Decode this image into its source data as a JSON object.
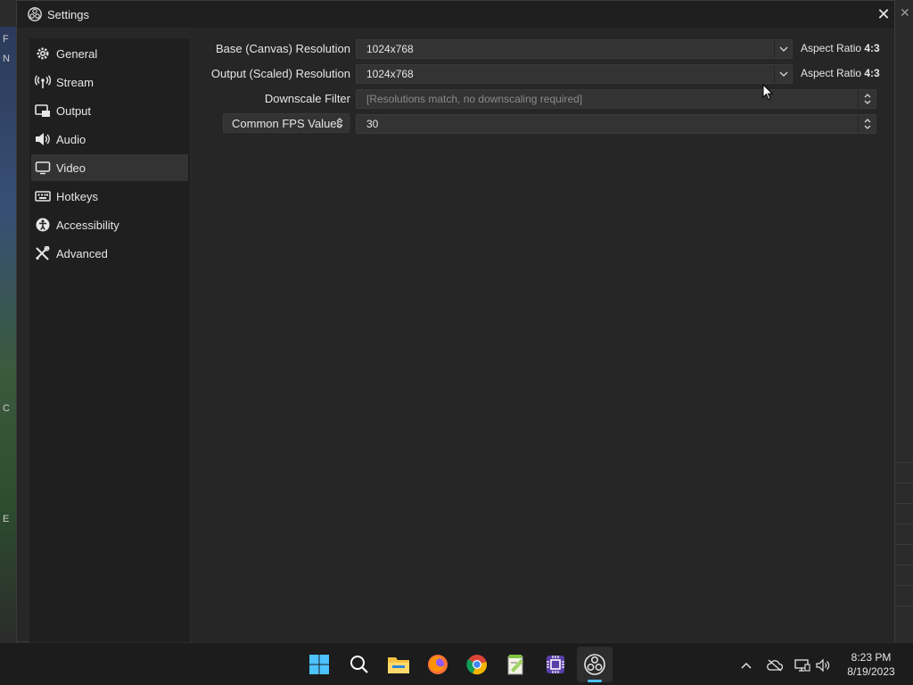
{
  "window": {
    "title": "Settings",
    "close_glyph": "✕"
  },
  "background_app": {
    "edge_texts": [
      "F",
      "N",
      "C",
      "E"
    ],
    "close_glyph": "✕"
  },
  "sidebar": {
    "items": [
      {
        "label": "General",
        "icon": "gear-icon",
        "active": false
      },
      {
        "label": "Stream",
        "icon": "antenna-icon",
        "active": false
      },
      {
        "label": "Output",
        "icon": "output-icon",
        "active": false
      },
      {
        "label": "Audio",
        "icon": "speaker-icon",
        "active": false
      },
      {
        "label": "Video",
        "icon": "monitor-icon",
        "active": true
      },
      {
        "label": "Hotkeys",
        "icon": "keyboard-icon",
        "active": false
      },
      {
        "label": "Accessibility",
        "icon": "accessibility-icon",
        "active": false
      },
      {
        "label": "Advanced",
        "icon": "wrench-icon",
        "active": false
      }
    ]
  },
  "video": {
    "base_resolution": {
      "label": "Base (Canvas) Resolution",
      "value": "1024x768",
      "aspect_prefix": "Aspect Ratio ",
      "aspect_value": "4:3"
    },
    "output_resolution": {
      "label": "Output (Scaled) Resolution",
      "value": "1024x768",
      "aspect_prefix": "Aspect Ratio ",
      "aspect_value": "4:3"
    },
    "downscale_filter": {
      "label": "Downscale Filter",
      "value": "[Resolutions match, no downscaling required]"
    },
    "fps": {
      "type_label": "Common FPS Values",
      "value": "30"
    }
  },
  "taskbar": {
    "apps": [
      "windows-start-icon",
      "search-icon",
      "file-explorer-icon",
      "firefox-icon",
      "chrome-icon",
      "notepad-plus-plus-icon",
      "cpu-z-icon",
      "obs-icon"
    ],
    "tray": [
      "chevron-up-icon",
      "cloud-offline-icon",
      "network-icon",
      "volume-icon"
    ],
    "time": "8:23 PM",
    "date": "8/19/2023"
  },
  "colors": {
    "accent": "#4cc2ff",
    "dialog_bg": "#272727",
    "sidebar_bg": "#1f1f1f",
    "control_bg": "#333333"
  }
}
